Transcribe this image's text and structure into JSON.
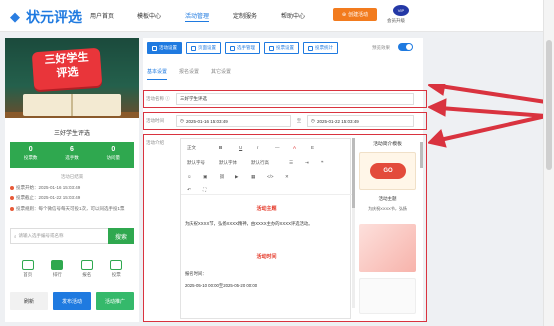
{
  "header": {
    "logo": "状元评选",
    "nav": [
      "用户首页",
      "模板中心",
      "活动管理",
      "定制服务",
      "帮助中心"
    ],
    "nav_active": 2,
    "create_label": "创建活动",
    "vip_badge": "VIP",
    "vip_text": "会员升级"
  },
  "preview": {
    "cover_title_line1": "三好学生",
    "cover_title_line2": "评选",
    "card_title": "三好学生评选",
    "stats": [
      {
        "num": "0",
        "label": "投票数"
      },
      {
        "num": "6",
        "label": "选手数"
      },
      {
        "num": "0",
        "label": "访问量"
      }
    ],
    "stats_caption": "活动已结束",
    "info": [
      "投票开始：2025-01-16 15:03:49",
      "投票截止：2025-01-22 15:03:49",
      "投票规则：每个微信号每天可投1次，可以同选手投1票"
    ],
    "search_placeholder": "请输入选手编号或名称",
    "search_btn": "搜索",
    "bottom_icons": [
      "首页",
      "排行",
      "报名",
      "投票"
    ],
    "bottom_bar": [
      "刷新",
      "发布活动",
      "活动推广"
    ]
  },
  "editor": {
    "toolbar_btns": [
      "活动设置",
      "页面设置",
      "选手管理",
      "投票设置",
      "投票统计"
    ],
    "toolbar_active": 0,
    "preview_label": "预览效果",
    "subtabs": [
      "基本设置",
      "报名设置",
      "其它设置"
    ],
    "name_label": "活动名称",
    "name_value": "三好学生评选",
    "time_label": "活动时间",
    "time_start": "2025-01-16 15:03:49",
    "time_sep": "至",
    "time_end": "2025-01-22 15:03:49",
    "desc_label": "活动介绍",
    "tools_row1": [
      "正文",
      "B",
      "U",
      "I",
      "—",
      "A",
      "E"
    ],
    "tools_row2": [
      "默认字号",
      "默认字体",
      "默认行高"
    ],
    "content_head1": "活动主题",
    "content_text1": "为庆祝XXXX节，弘扬XXXX精神，由XXXX主办的XXXX评选活动。",
    "content_head2": "活动时间",
    "content_text2": "报名时间：",
    "content_text3": "2025-05-10 00:00至2025-05-20 00:00",
    "template_title": "活动简介模板",
    "template_caption": "活动主题",
    "template_caption2": "为庆祝XXXX节，弘扬"
  },
  "colors": {
    "brand": "#1f7ae0",
    "green": "#2fa84f",
    "orange": "#f27b1e",
    "highlight": "#d9333f"
  }
}
